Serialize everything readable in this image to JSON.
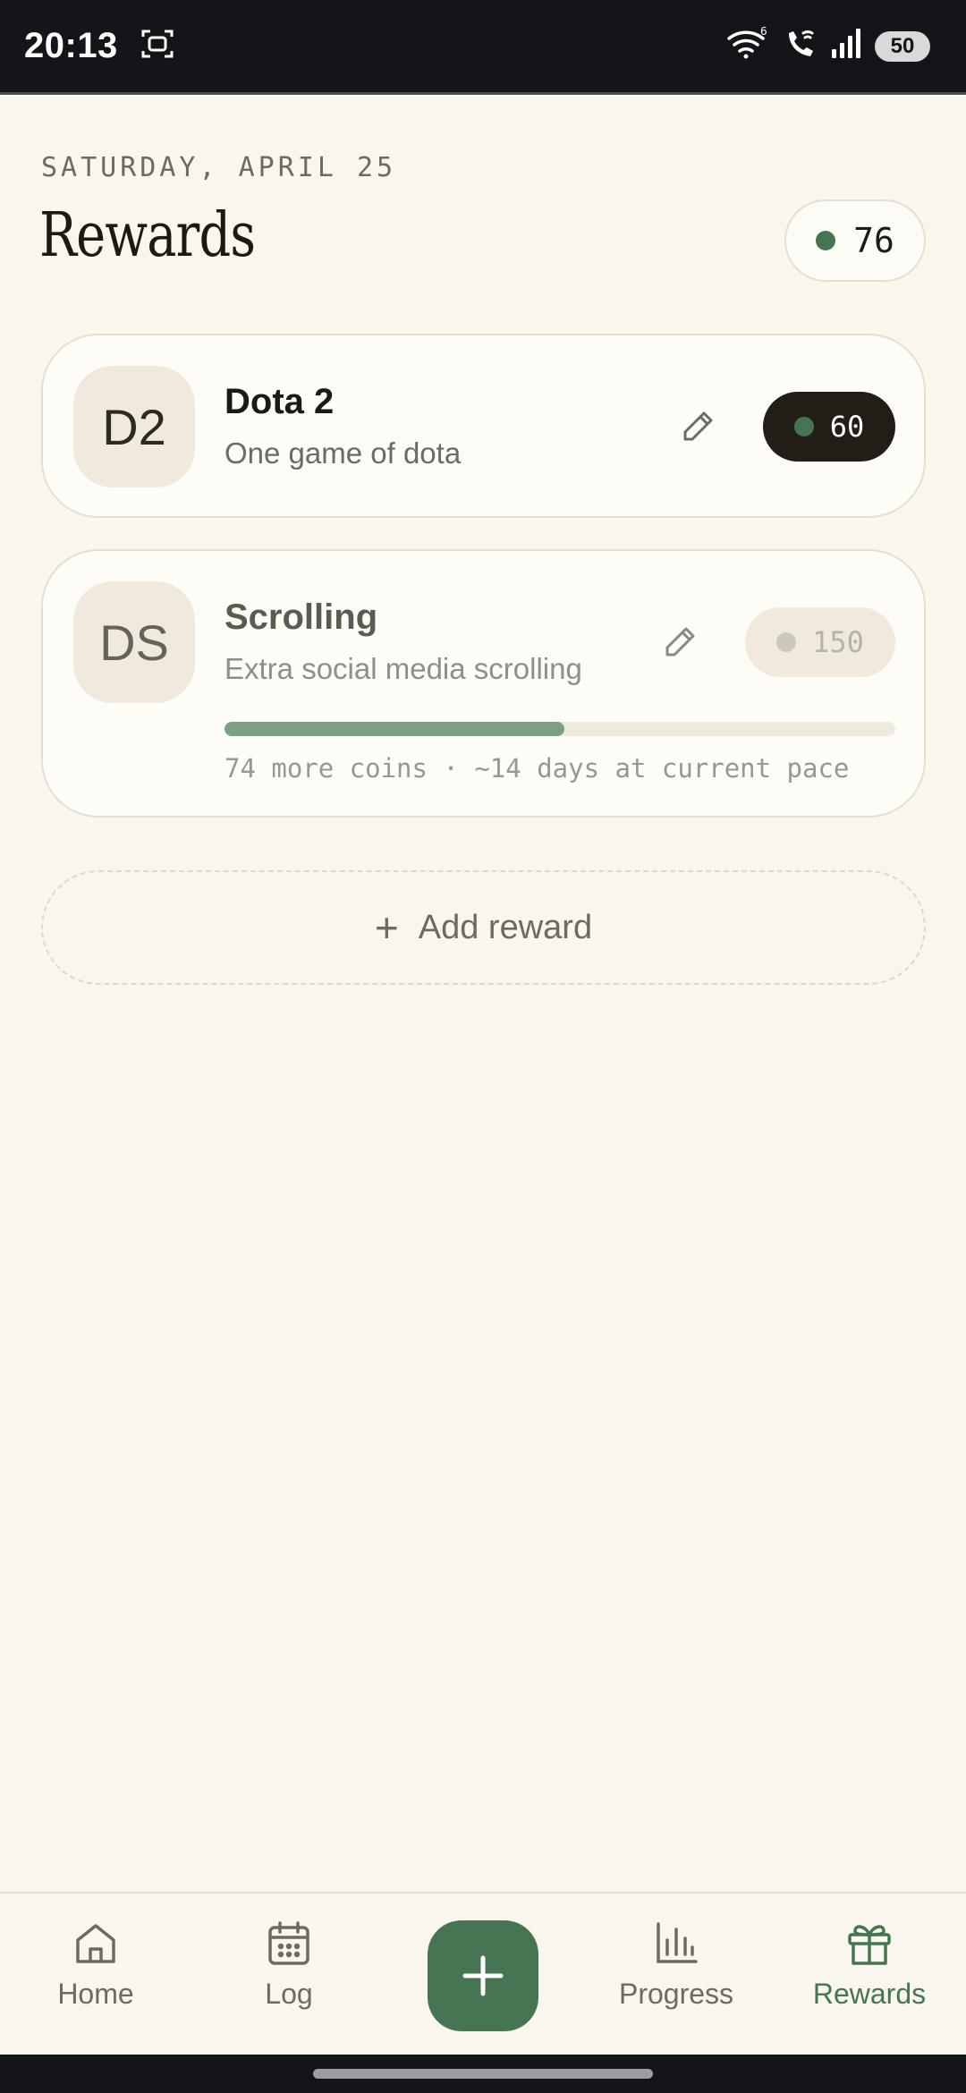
{
  "status_bar": {
    "time": "20:13",
    "battery": "50",
    "icons": [
      "screenshot-icon",
      "wifi-icon",
      "wifi-call-icon",
      "signal-icon",
      "battery-icon"
    ]
  },
  "header": {
    "date": "SATURDAY, APRIL 25",
    "title": "Rewards",
    "coin_balance": "76"
  },
  "rewards": [
    {
      "initials": "D2",
      "name": "Dota 2",
      "description": "One game of dota",
      "cost": "60",
      "affordable": true
    },
    {
      "initials": "DS",
      "name": "Scrolling",
      "description": "Extra social media scrolling",
      "cost": "150",
      "affordable": false,
      "progress": 0.507,
      "progress_text": "74 more coins · ~14 days at current pace"
    }
  ],
  "add_reward": {
    "plus": "+",
    "label": "Add reward"
  },
  "nav": {
    "home": "Home",
    "log": "Log",
    "progress": "Progress",
    "rewards": "Rewards",
    "active": "rewards"
  },
  "colors": {
    "background": "#f9f6ed",
    "accent": "#477553",
    "progress_fill": "#7e9f82",
    "dark_pill": "#221e17"
  }
}
